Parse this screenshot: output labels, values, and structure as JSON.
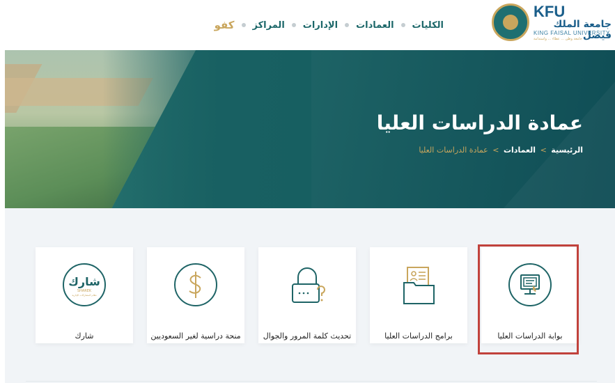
{
  "logo": {
    "abbr": "KFU",
    "name_ar": "جامعة الملك فيصل",
    "name_en": "KING FAISAL UNIVERSITY",
    "tagline": "جامعة وطن ... عطاء ... واستدامة"
  },
  "topnav": {
    "items": [
      "الكليات",
      "العمادات",
      "الإدارات",
      "المراكز"
    ],
    "brand": "كفو"
  },
  "hero": {
    "title": "عمادة الدراسات العليا",
    "breadcrumb": {
      "home": "الرئيسية",
      "deanships": "العمادات",
      "current": "عمادة الدراسات العليا",
      "separator": ">"
    }
  },
  "cards": [
    {
      "label": "بوابة الدراسات العليا",
      "icon": "portal-screen-icon"
    },
    {
      "label": "برامج الدراسات العليا",
      "icon": "programs-folder-icon"
    },
    {
      "label": "تحديث كلمة المرور والجوال",
      "icon": "password-lock-icon"
    },
    {
      "label": "منحة دراسية لغير السعوديين",
      "icon": "dollar-scholarship-icon"
    },
    {
      "label": "شارك",
      "icon": "sharek-logo-icon"
    }
  ],
  "sharek": {
    "ar": "شارك",
    "en": "SHAREK",
    "sub": "نظام المشاركات الإدارية"
  },
  "colors": {
    "teal": "#1e6466",
    "gold": "#c9a65d",
    "highlight": "#c1423c"
  }
}
